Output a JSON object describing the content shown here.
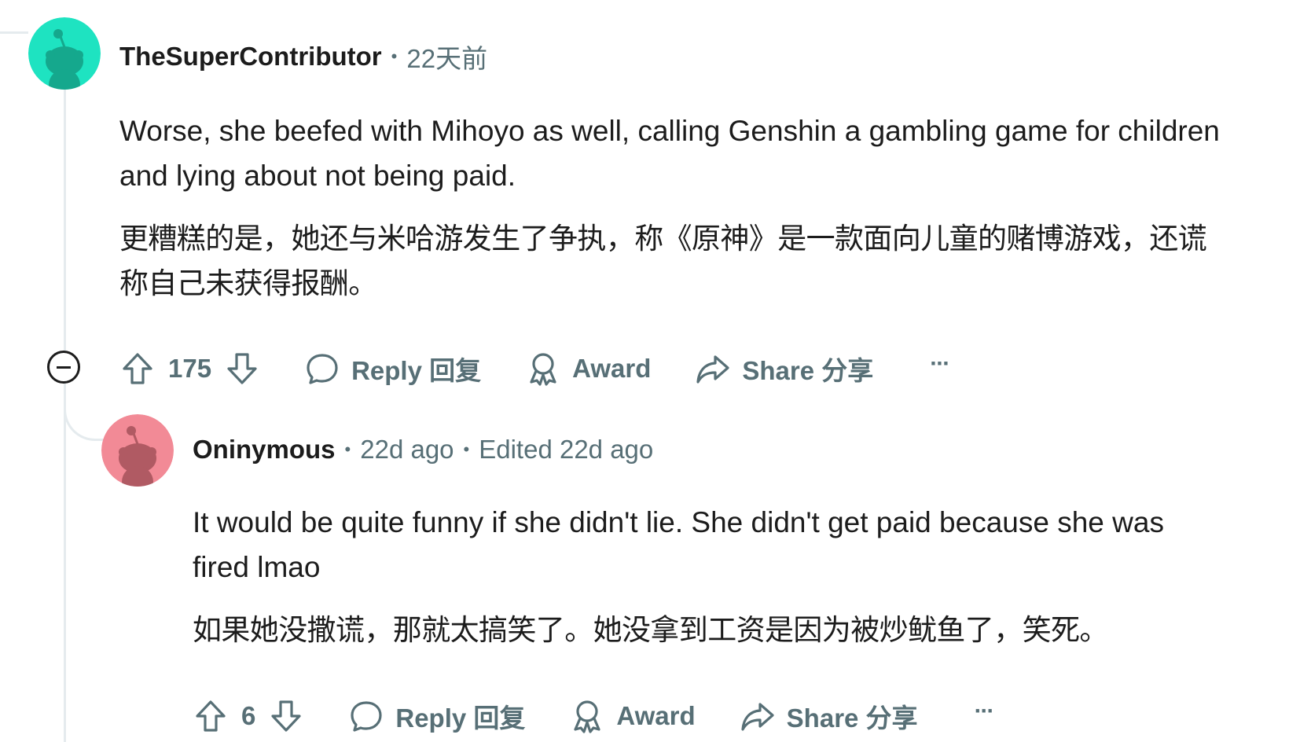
{
  "comments": [
    {
      "username": "TheSuperContributor",
      "time": "22天前",
      "body_en": "Worse, she beefed with Mihoyo as well, calling Genshin a gambling game for children and lying about not being paid.",
      "body_zh": "更糟糕的是，她还与米哈游发生了争执，称《原神》是一款面向儿童的赌博游戏，还谎称自己未获得报酬。",
      "votes": "175",
      "reply_label": "Reply 回复",
      "award_label": "Award",
      "share_label": "Share 分享",
      "more_label": "···",
      "avatar_color": "#1ee3c1",
      "avatar_figure_color": "#15a88d"
    },
    {
      "username": "Oninymous",
      "time": "22d ago",
      "edited": "Edited 22d ago",
      "body_en": "It would be quite funny if she didn't lie. She didn't get paid because she was fired lmao",
      "body_zh": "如果她没撒谎，那就太搞笑了。她没拿到工资是因为被炒鱿鱼了，笑死。",
      "votes": "6",
      "reply_label": "Reply 回复",
      "award_label": "Award",
      "share_label": "Share 分享",
      "more_label": "···",
      "avatar_color": "#f28a96",
      "avatar_figure_color": "#b05a63"
    }
  ],
  "icons": {
    "upvote": "arrow-up-icon",
    "downvote": "arrow-down-icon",
    "reply": "speech-bubble-icon",
    "award": "award-ribbon-icon",
    "share": "share-arrow-icon",
    "collapse": "collapse-minus-icon"
  }
}
